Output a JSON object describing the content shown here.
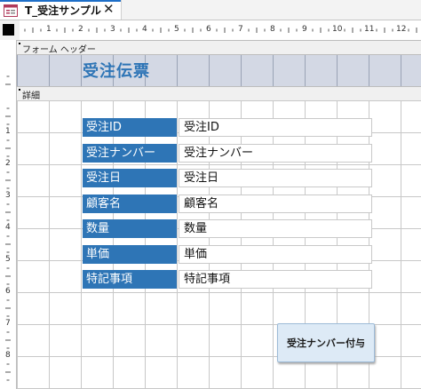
{
  "tab": {
    "title": "T_受注サンプル",
    "close": "✕",
    "icon": "form-icon"
  },
  "rulers": {
    "horizontal": [
      "1",
      "2",
      "3",
      "4",
      "5",
      "6",
      "7",
      "8",
      "9",
      "10",
      "11",
      "12"
    ],
    "vertical": [
      "1",
      "2",
      "3",
      "4",
      "5",
      "6",
      "7",
      "8"
    ]
  },
  "sections": {
    "header_label": "フォーム ヘッダー",
    "detail_label": "詳細"
  },
  "form": {
    "title": "受注伝票",
    "fields": [
      {
        "label": "受注ID",
        "value": "受注ID"
      },
      {
        "label": "受注ナンバー",
        "value": "受注ナンバー"
      },
      {
        "label": "受注日",
        "value": "受注日"
      },
      {
        "label": "顧客名",
        "value": "顧客名"
      },
      {
        "label": "数量",
        "value": "数量"
      },
      {
        "label": "単価",
        "value": "単価"
      },
      {
        "label": "特記事項",
        "value": "特記事項"
      }
    ],
    "button_label": "受注ナンバー付与"
  },
  "colors": {
    "label_bg": "#2e75b6",
    "title": "#2e75b6",
    "tab_accent": "#1e6fc8"
  }
}
